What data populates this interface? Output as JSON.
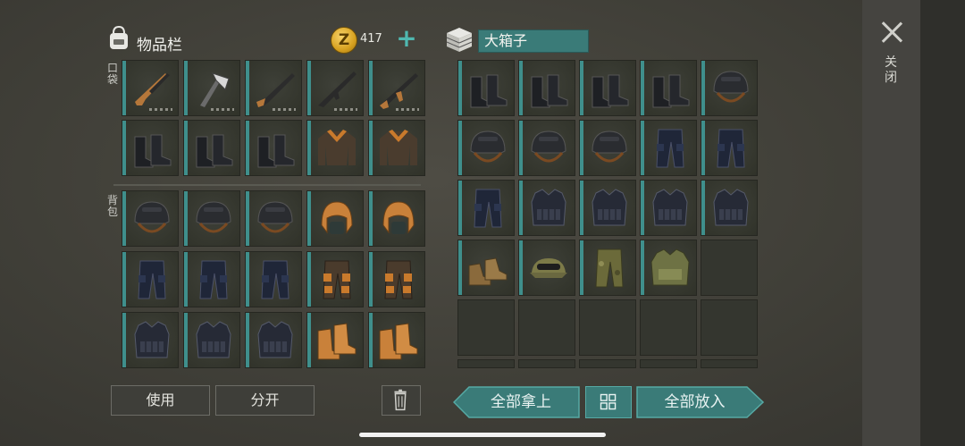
{
  "inventory": {
    "title": "物品栏",
    "coin_count": "417",
    "coin_symbol": "Z",
    "add_label": "+",
    "pockets_label": "口袋",
    "backpack_label": "背包",
    "pockets": [
      {
        "item": "hunting-rifle-icon",
        "durability": true
      },
      {
        "item": "axe-icon",
        "durability": true
      },
      {
        "item": "shotgun-icon",
        "durability": true
      },
      {
        "item": "assault-rifle-icon",
        "durability": true
      },
      {
        "item": "ak-rifle-icon",
        "durability": true
      },
      {
        "item": "boots-icon"
      },
      {
        "item": "boots-icon"
      },
      {
        "item": "boots-icon"
      },
      {
        "item": "leather-jacket-icon"
      },
      {
        "item": "leather-jacket-icon"
      }
    ],
    "backpack": [
      {
        "item": "helmet-icon"
      },
      {
        "item": "helmet-icon"
      },
      {
        "item": "helmet-icon"
      },
      {
        "item": "winter-hat-icon"
      },
      {
        "item": "winter-hat-icon"
      },
      {
        "item": "pants-icon"
      },
      {
        "item": "pants-icon"
      },
      {
        "item": "pants-icon"
      },
      {
        "item": "leather-pants-icon"
      },
      {
        "item": "leather-pants-icon"
      },
      {
        "item": "body-armor-icon"
      },
      {
        "item": "body-armor-icon"
      },
      {
        "item": "body-armor-icon"
      },
      {
        "item": "fur-boots-icon"
      },
      {
        "item": "fur-boots-icon"
      }
    ],
    "use_label": "使用",
    "split_label": "分开"
  },
  "box": {
    "title": "大箱子",
    "slots": [
      {
        "item": "boots-icon"
      },
      {
        "item": "boots-icon"
      },
      {
        "item": "boots-icon"
      },
      {
        "item": "boots-icon"
      },
      {
        "item": "helmet-icon"
      },
      {
        "item": "helmet-icon"
      },
      {
        "item": "helmet-icon"
      },
      {
        "item": "helmet-icon"
      },
      {
        "item": "pants-icon"
      },
      {
        "item": "pants-icon"
      },
      {
        "item": "pants-icon"
      },
      {
        "item": "body-armor-icon"
      },
      {
        "item": "body-armor-icon"
      },
      {
        "item": "body-armor-icon"
      },
      {
        "item": "body-armor-icon"
      },
      {
        "item": "desert-boots-icon"
      },
      {
        "item": "tactical-cap-icon"
      },
      {
        "item": "camo-pants-icon"
      },
      {
        "item": "camo-vest-icon"
      },
      {
        "item": ""
      },
      {
        "item": ""
      },
      {
        "item": ""
      },
      {
        "item": ""
      },
      {
        "item": ""
      },
      {
        "item": ""
      },
      {
        "item": ""
      },
      {
        "item": ""
      },
      {
        "item": ""
      },
      {
        "item": ""
      },
      {
        "item": ""
      }
    ],
    "take_all_label": "全部拿上",
    "sort_label": "品",
    "put_all_label": "全部放入"
  },
  "close_label": "关闭",
  "colors": {
    "accent": "#3a7b78",
    "accent_light": "#4fb8b0",
    "slot_bar": "#3f8f8c"
  }
}
